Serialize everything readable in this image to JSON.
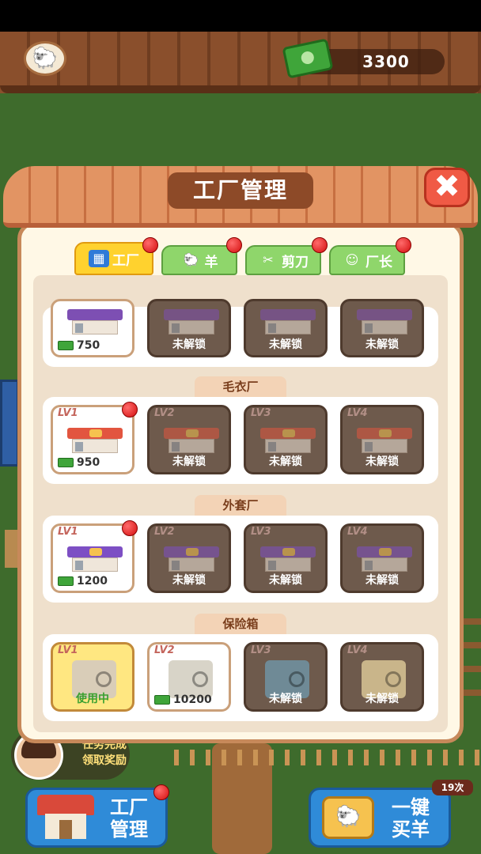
{
  "header": {
    "money": "3300"
  },
  "modal": {
    "title": "工厂管理",
    "close": "✖"
  },
  "tabs": [
    {
      "label": "工厂",
      "icon": "shop-icon",
      "active": true
    },
    {
      "label": "羊",
      "icon": "sheep-icon",
      "active": false
    },
    {
      "label": "剪刀",
      "icon": "scissors-icon",
      "active": false
    },
    {
      "label": "厂长",
      "icon": "manager-icon",
      "active": false
    }
  ],
  "sections": [
    {
      "name": "",
      "tiles": [
        {
          "lv": "",
          "state": "unlocked",
          "text": "750",
          "roof": "#7d4fb3"
        },
        {
          "lv": "",
          "state": "locked",
          "text": "未解锁",
          "roof": "#7d4fb3"
        },
        {
          "lv": "",
          "state": "locked",
          "text": "未解锁",
          "roof": "#7d4fb3"
        },
        {
          "lv": "",
          "state": "locked",
          "text": "未解锁",
          "roof": "#7d4fb3"
        }
      ]
    },
    {
      "name": "毛衣厂",
      "tiles": [
        {
          "lv": "LV1",
          "state": "unlocked",
          "text": "950",
          "roof": "#e2553f"
        },
        {
          "lv": "LV2",
          "state": "locked",
          "text": "未解锁",
          "roof": "#e2553f"
        },
        {
          "lv": "LV3",
          "state": "locked",
          "text": "未解锁",
          "roof": "#e2553f"
        },
        {
          "lv": "LV4",
          "state": "locked",
          "text": "未解锁",
          "roof": "#e2553f"
        }
      ]
    },
    {
      "name": "外套厂",
      "tiles": [
        {
          "lv": "LV1",
          "state": "unlocked",
          "text": "1200",
          "roof": "#7d4fc4"
        },
        {
          "lv": "LV2",
          "state": "locked",
          "text": "未解锁",
          "roof": "#7d4fc4"
        },
        {
          "lv": "LV3",
          "state": "locked",
          "text": "未解锁",
          "roof": "#7d4fc4"
        },
        {
          "lv": "LV4",
          "state": "locked",
          "text": "未解锁",
          "roof": "#7d4fc4"
        }
      ]
    },
    {
      "name": "保险箱",
      "tiles": [
        {
          "lv": "LV1",
          "state": "inuse",
          "text": "使用中",
          "safe": "#d9cdb8"
        },
        {
          "lv": "LV2",
          "state": "unlocked",
          "text": "10200",
          "safe": "#d8d4c8"
        },
        {
          "lv": "LV3",
          "state": "locked",
          "text": "未解锁",
          "safe": "#6f8a96"
        },
        {
          "lv": "LV4",
          "state": "locked",
          "text": "未解锁",
          "safe": "#c9b58a"
        }
      ]
    }
  ],
  "task": {
    "line1": "任务完成",
    "line2": "领取奖励"
  },
  "buttons": {
    "factory_line1": "工厂",
    "factory_line2": "管理",
    "buy_line1": "一键",
    "buy_line2": "买羊",
    "buy_count": "19次"
  }
}
